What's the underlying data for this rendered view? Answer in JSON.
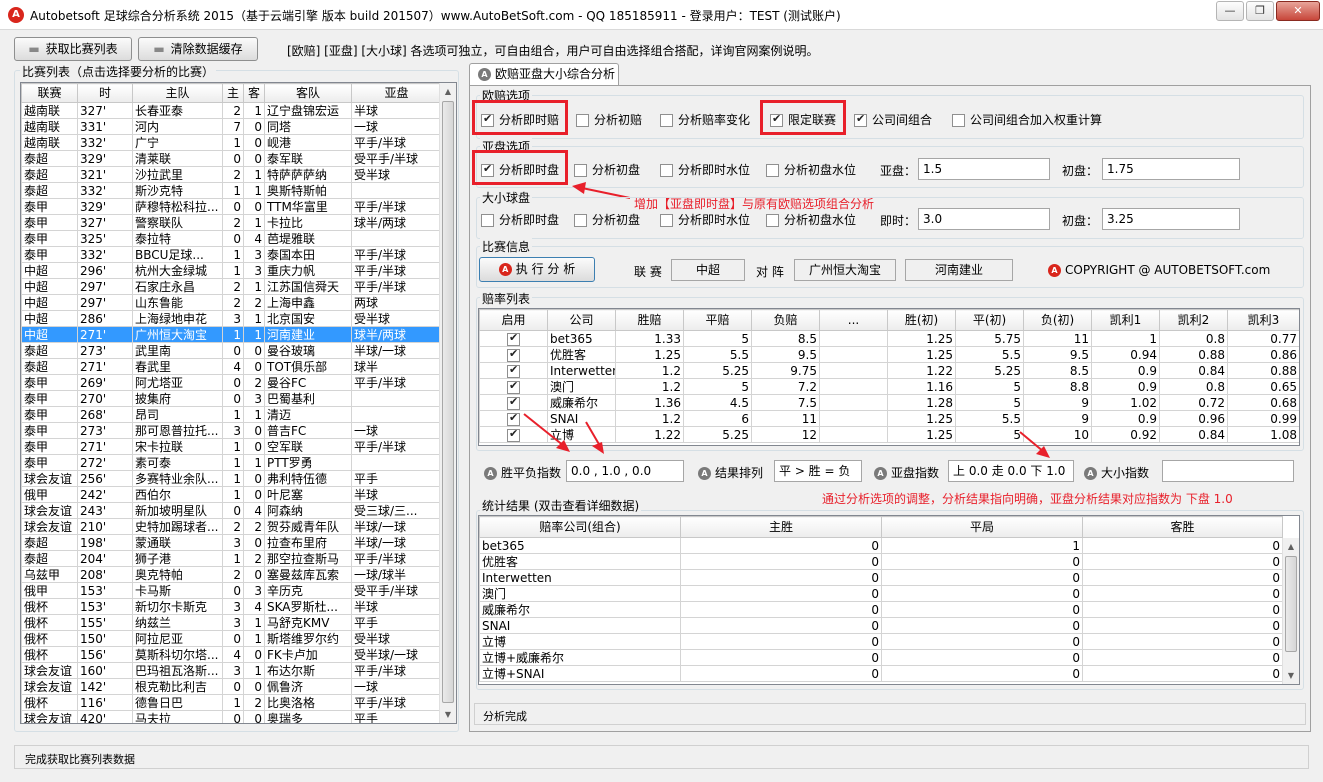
{
  "window": {
    "title": "Autobetsoft 足球综合分析系统 2015（基于云端引擎 版本 build 201507）www.AutoBetSoft.com  - QQ 185185911  - 登录用户：TEST (测试账户)",
    "icon": "A"
  },
  "toolbar": {
    "fetch_label": "获取比赛列表",
    "clear_label": "清除数据缓存",
    "info": "[欧赔] [亚盘] [大小球] 各选项可独立，可自由组合，用户可自由选择组合搭配，详询官网案例说明。"
  },
  "match_list": {
    "title": "比赛列表（点击选择要分析的比赛）",
    "columns": [
      "联赛",
      "时",
      "主队",
      "主",
      "客",
      "客队",
      "亚盘"
    ],
    "rows": [
      [
        "越南联",
        "327'",
        "长春亚泰",
        "2",
        "1",
        "辽宁盘锦宏运",
        "半球"
      ],
      [
        "越南联",
        "331'",
        "河内",
        "7",
        "0",
        "同塔",
        "一球"
      ],
      [
        "越南联",
        "332'",
        "广宁",
        "1",
        "0",
        "岘港",
        "平手/半球"
      ],
      [
        "泰超",
        "329'",
        "清莱联",
        "0",
        "0",
        "泰军联",
        "受平手/半球"
      ],
      [
        "泰超",
        "321'",
        "沙拉武里",
        "2",
        "1",
        "特萨萨萨纳",
        "受半球"
      ],
      [
        "泰超",
        "332'",
        "斯沙克特",
        "1",
        "1",
        "奥斯特斯帕",
        ""
      ],
      [
        "泰甲",
        "329'",
        "萨穆特松科拉...",
        "0",
        "0",
        "TTM华富里",
        "平手/半球"
      ],
      [
        "泰甲",
        "327'",
        "警察联队",
        "2",
        "1",
        "卡拉比",
        "球半/两球"
      ],
      [
        "泰甲",
        "325'",
        "泰拉特",
        "0",
        "4",
        "芭堤雅联",
        ""
      ],
      [
        "泰甲",
        "332'",
        "BBCU足球...",
        "1",
        "3",
        "泰国本田",
        "平手/半球"
      ],
      [
        "中超",
        "296'",
        "杭州大金绿城",
        "1",
        "3",
        "重庆力帆",
        "平手/半球"
      ],
      [
        "中超",
        "297'",
        "石家庄永昌",
        "2",
        "1",
        "江苏国信舜天",
        "平手/半球"
      ],
      [
        "中超",
        "297'",
        "山东鲁能",
        "2",
        "2",
        "上海申鑫",
        "两球"
      ],
      [
        "中超",
        "286'",
        "上海绿地申花",
        "3",
        "1",
        "北京国安",
        "受半球"
      ],
      [
        "中超",
        "271'",
        "广州恒大淘宝",
        "1",
        "1",
        "河南建业",
        "球半/两球"
      ],
      [
        "泰超",
        "273'",
        "武里南",
        "0",
        "0",
        "曼谷玻璃",
        "半球/一球"
      ],
      [
        "泰超",
        "271'",
        "春武里",
        "4",
        "0",
        "TOT俱乐部",
        "球半"
      ],
      [
        "泰甲",
        "269'",
        "阿尤塔亚",
        "0",
        "2",
        "曼谷FC",
        "平手/半球"
      ],
      [
        "泰甲",
        "270'",
        "披集府",
        "0",
        "3",
        "巴蜀基利",
        ""
      ],
      [
        "泰甲",
        "268'",
        "昂司",
        "1",
        "1",
        "清迈",
        ""
      ],
      [
        "泰甲",
        "273'",
        "那可恩普拉托...",
        "3",
        "0",
        "普吉FC",
        "一球"
      ],
      [
        "泰甲",
        "271'",
        "宋卡拉联",
        "1",
        "0",
        "空军联",
        "平手/半球"
      ],
      [
        "泰甲",
        "272'",
        "素可泰",
        "1",
        "1",
        "PTT罗勇",
        ""
      ],
      [
        "球会友谊",
        "256'",
        "多赛特业余队...",
        "1",
        "0",
        "弗利特伍德",
        "平手"
      ],
      [
        "俄甲",
        "242'",
        "西伯尔",
        "1",
        "0",
        "叶尼塞",
        "半球"
      ],
      [
        "球会友谊",
        "243'",
        "新加坡明星队",
        "0",
        "4",
        "阿森纳",
        "受三球/三..."
      ],
      [
        "球会友谊",
        "210'",
        "史特加踢球者...",
        "2",
        "2",
        "贺芬威青年队",
        "半球/一球"
      ],
      [
        "泰超",
        "198'",
        "蒙通联",
        "3",
        "0",
        "拉查布里府",
        "半球/一球"
      ],
      [
        "泰超",
        "204'",
        "狮子港",
        "1",
        "2",
        "那空拉查斯马",
        "平手/半球"
      ],
      [
        "乌兹甲",
        "208'",
        "奥克特帕",
        "2",
        "0",
        "塞曼兹库瓦索",
        "一球/球半"
      ],
      [
        "俄甲",
        "153'",
        "卡马斯",
        "0",
        "3",
        "辛历克",
        "受平手/半球"
      ],
      [
        "俄杯",
        "153'",
        "新切尔卡斯克",
        "3",
        "4",
        "SKA罗斯杜...",
        "半球"
      ],
      [
        "俄杯",
        "155'",
        "纳兹兰",
        "3",
        "1",
        "马舒克KMV",
        "平手"
      ],
      [
        "俄杯",
        "150'",
        "阿拉尼亚",
        "0",
        "1",
        "斯塔维罗尔约",
        "受半球"
      ],
      [
        "俄杯",
        "156'",
        "莫斯科切尔塔...",
        "4",
        "0",
        "FK卡卢加",
        "受半球/一球"
      ],
      [
        "球会友谊",
        "160'",
        "巴玛祖瓦洛斯...",
        "3",
        "1",
        "布达尔斯",
        "平手/半球"
      ],
      [
        "球会友谊",
        "142'",
        "根克勒比利吉",
        "0",
        "0",
        "佩鲁济",
        "一球"
      ],
      [
        "俄杯",
        "116'",
        "德鲁日巴",
        "1",
        "2",
        "比奥洛格",
        "平手/半球"
      ],
      [
        "球会友谊",
        "420'",
        "马夫拉",
        "0",
        "0",
        "奥瑞多",
        "平手"
      ]
    ],
    "selected_index": 14
  },
  "tab": {
    "label": "欧赔亚盘大小综合分析",
    "icon": "A"
  },
  "euro": {
    "title": "欧赔选项",
    "options": [
      {
        "label": "分析即时赔",
        "checked": true
      },
      {
        "label": "分析初赔",
        "checked": false
      },
      {
        "label": "分析赔率变化",
        "checked": false
      },
      {
        "label": "限定联赛",
        "checked": true
      },
      {
        "label": "公司间组合",
        "checked": true
      },
      {
        "label": "公司间组合加入权重计算",
        "checked": false
      }
    ]
  },
  "asian": {
    "title": "亚盘选项",
    "options": [
      {
        "label": "分析即时盘",
        "checked": true
      },
      {
        "label": "分析初盘",
        "checked": false
      },
      {
        "label": "分析即时水位",
        "checked": false
      },
      {
        "label": "分析初盘水位",
        "checked": false
      }
    ],
    "live_label": "亚盘：",
    "live_value": "1.5",
    "init_label": "初盘：",
    "init_value": "1.75"
  },
  "annotation1": "增加【亚盘即时盘】与原有欧赔选项组合分析",
  "ou": {
    "title": "大小球盘",
    "options": [
      {
        "label": "分析即时盘",
        "checked": false
      },
      {
        "label": "分析初盘",
        "checked": false
      },
      {
        "label": "分析即时水位",
        "checked": false
      },
      {
        "label": "分析初盘水位",
        "checked": false
      }
    ],
    "live_label": "即时：",
    "live_value": "3.0",
    "init_label": "初盘：",
    "init_value": "3.25"
  },
  "match_info": {
    "title": "比赛信息",
    "run_label": "执 行 分 析",
    "league_label": "联 赛",
    "league_value": "中超",
    "vs_label": "对 阵",
    "home": "广州恒大淘宝",
    "away": "河南建业",
    "copyright": "COPYRIGHT @ AUTOBETSOFT.com"
  },
  "odds": {
    "title": "赔率列表",
    "columns": [
      "启用",
      "公司",
      "胜赔",
      "平赔",
      "负赔",
      "...",
      "胜(初)",
      "平(初)",
      "负(初)",
      "凯利1",
      "凯利2",
      "凯利3"
    ],
    "rows": [
      [
        "bet365",
        "1.33",
        "5",
        "8.5",
        "",
        "1.25",
        "5.75",
        "11",
        "1",
        "0.8",
        "0.77"
      ],
      [
        "优胜客",
        "1.25",
        "5.5",
        "9.5",
        "",
        "1.25",
        "5.5",
        "9.5",
        "0.94",
        "0.88",
        "0.86"
      ],
      [
        "Interwetten",
        "1.2",
        "5.25",
        "9.75",
        "",
        "1.22",
        "5.25",
        "8.5",
        "0.9",
        "0.84",
        "0.88"
      ],
      [
        "澳门",
        "1.2",
        "5",
        "7.2",
        "",
        "1.16",
        "5",
        "8.8",
        "0.9",
        "0.8",
        "0.65"
      ],
      [
        "威廉希尔",
        "1.36",
        "4.5",
        "7.5",
        "",
        "1.28",
        "5",
        "9",
        "1.02",
        "0.72",
        "0.68"
      ],
      [
        "SNAI",
        "1.2",
        "6",
        "11",
        "",
        "1.25",
        "5.5",
        "9",
        "0.9",
        "0.96",
        "0.99"
      ],
      [
        "立博",
        "1.22",
        "5.25",
        "12",
        "",
        "1.25",
        "5",
        "10",
        "0.92",
        "0.84",
        "1.08"
      ]
    ]
  },
  "indices": {
    "wdl_label": "胜平负指数",
    "wdl_value": "0.0 , 1.0 , 0.0",
    "order_label": "结果排列",
    "order_value": "平 > 胜 = 负",
    "asian_label": "亚盘指数",
    "asian_value": "上 0.0 走 0.0 下 1.0",
    "ou_label": "大小指数",
    "ou_value": ""
  },
  "annotation2": "通过分析选项的调整，分析结果指向明确，亚盘分析结果对应指数为 下盘 1.0",
  "stats": {
    "title": "统计结果 (双击查看详细数据)",
    "columns": [
      "赔率公司(组合)",
      "主胜",
      "平局",
      "客胜"
    ],
    "rows": [
      [
        "bet365",
        "0",
        "1",
        "0"
      ],
      [
        "优胜客",
        "0",
        "0",
        "0"
      ],
      [
        "Interwetten",
        "0",
        "0",
        "0"
      ],
      [
        "澳门",
        "0",
        "0",
        "0"
      ],
      [
        "威廉希尔",
        "0",
        "0",
        "0"
      ],
      [
        "SNAI",
        "0",
        "0",
        "0"
      ],
      [
        "立博",
        "0",
        "0",
        "0"
      ],
      [
        "立博+威廉希尔",
        "0",
        "0",
        "0"
      ],
      [
        "立博+SNAI",
        "0",
        "0",
        "0"
      ]
    ]
  },
  "status": {
    "analysis": "分析完成",
    "main": "完成获取比赛列表数据"
  },
  "icons": {
    "minimize": "minimize-icon",
    "restore": "restore-icon",
    "close": "close-icon"
  },
  "colors": {
    "highlight_red": "#e8202b",
    "selection_blue": "#3399ff"
  }
}
